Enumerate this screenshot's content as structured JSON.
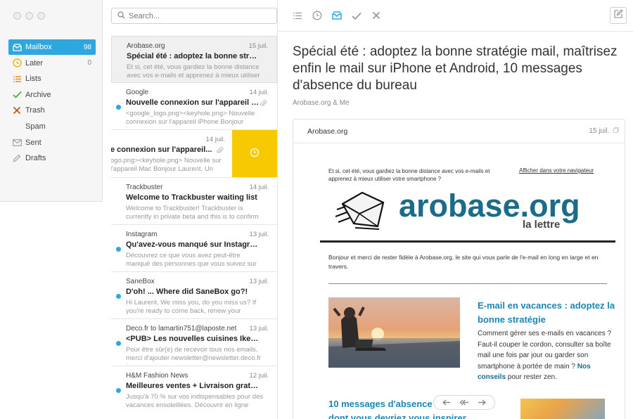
{
  "search": {
    "placeholder": "Search..."
  },
  "sidebar": {
    "items": [
      {
        "label": "Mailbox",
        "count": "98",
        "icon": "mailbox-icon"
      },
      {
        "label": "Later",
        "count": "0",
        "icon": "clock-icon"
      },
      {
        "label": "Lists",
        "count": "",
        "icon": "list-icon"
      },
      {
        "label": "Archive",
        "count": "",
        "icon": "check-icon"
      },
      {
        "label": "Trash",
        "count": "",
        "icon": "x-icon"
      },
      {
        "label": "Spam",
        "count": "",
        "icon": ""
      },
      {
        "label": "Sent",
        "count": "",
        "icon": "envelope-icon"
      },
      {
        "label": "Drafts",
        "count": "",
        "icon": "pencil-icon"
      }
    ]
  },
  "messages": [
    {
      "from": "Arobase.org",
      "date": "15 juil.",
      "subject": "Spécial été : adoptez la bonne stratégi...",
      "preview": "Et si, cet été, vous gardiez la bonne distance avec vos e-mails et apprenez à mieux utiliser",
      "unread": false
    },
    {
      "from": "Google",
      "date": "14 juil.",
      "subject": "Nouvelle connexion sur l'appareil i...",
      "preview": "<google_logo.png><keyhole.png> Nouvelle connexion sur l'appareil iPhone Bonjour Laurent,",
      "unread": true
    },
    {
      "from": "",
      "date": "14 juil.",
      "subject": "e connexion sur l'appareil...",
      "preview": "ogo.png><keyhole.png> Nouvelle sur l'appareil Mac Bonjour Laurent, Un",
      "unread": false
    },
    {
      "from": "Trackbuster",
      "date": "14 juil.",
      "subject": "Welcome to Trackbuster waiting list",
      "preview": "Welcome to Trackbuster! Trackbuster is currently in private beta and this is to confirm you joined o",
      "unread": false
    },
    {
      "from": "Instagram",
      "date": "13 juil.",
      "subject": "Qu'avez-vous manqué sur Instagram c...",
      "preview": "Découvrez ce que vous avez peut-être manqué des personnes que vous suivez sur Instagram.",
      "unread": true
    },
    {
      "from": "SaneBox",
      "date": "13 juil.",
      "subject": "D'oh! ... Where did SaneBox go?!",
      "preview": "Hi Laurent, We miss you, do you miss us? If you're ready to come back, renew your",
      "unread": true
    },
    {
      "from": "Deco.fr to lamartin751@laposte.net",
      "date": "13 juil.",
      "subject": "<PUB> Les nouvelles cuisines Ikea, le...",
      "preview": "Pour être sûr(e) de recevoir tous nos emails, merci d'ajouter newsletter@newsletter.deco.fr à",
      "unread": true
    },
    {
      "from": "H&M Fashion News",
      "date": "12 juil.",
      "subject": "Meilleures ventes + Livraison gratuite,...",
      "preview": "Jusqu'à 70 % sur vos indispensables pour des vacances ensoleillées. Découvrir en ligne",
      "unread": true
    }
  ],
  "reader": {
    "title": "Spécial été : adoptez la bonne stratégie mail, maîtrisez enfin le mail sur iPhone et Android, 10 messages d'absence du bureau",
    "meta": "Arobase.org & Me",
    "card_from": "Arobase.org",
    "card_date": "15 juil.",
    "preheader": "Et si, cet été, vous gardiez la bonne distance avec vos e-mails et apprenez à mieux utiliser votre smartphone ?",
    "online_link": "Afficher dans votre navigateur",
    "logo_word": "arobase.org",
    "logo_sub": "la lettre",
    "intro": "Bonjour et merci de rester fidèle à Arobase.org, le site qui vous parle de l'e-mail en long en large et en travers.",
    "article_title": "E-mail en vacances : adoptez la bonne stratégie",
    "article_text_1": "Comment gérer ses e-mails en vacances ? Faut-il couper le cordon, consulter sa boîte mail une fois par jour ou garder son smartphone à portée de main ?",
    "article_link": "Nos conseils",
    "article_text_2": " pour rester zen.",
    "article2_title_1": "10 messages d'absence",
    "article2_title_2": "dont vous devriez vous inspirer"
  },
  "colors": {
    "accent": "#2ea7df",
    "later": "#f7c900",
    "archive": "#3cb54a",
    "trash": "#d35400",
    "brand": "#1b6b8a"
  }
}
